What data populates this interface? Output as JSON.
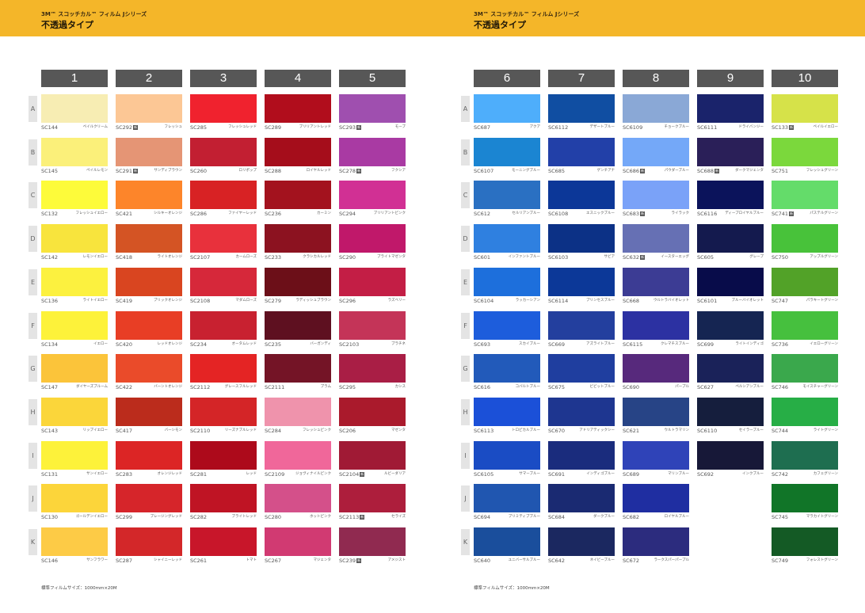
{
  "pages": [
    {
      "series": "3M™ スコッチカル™ フィルム Jシリーズ",
      "title": "不透過タイプ",
      "footnote": "標準フィルムサイズ：1000mm×20M",
      "columns": [
        {
          "label": "1",
          "cells": [
            {
              "code": "SC144",
              "mark": "",
              "name": "ペイルクリーム",
              "color": "#f7edb3"
            },
            {
              "code": "SC145",
              "mark": "",
              "name": "ペイルレモン",
              "color": "#fbf07a"
            },
            {
              "code": "SC132",
              "mark": "",
              "name": "フレッシュイエロー",
              "color": "#fdfb3a"
            },
            {
              "code": "SC142",
              "mark": "",
              "name": "レモンイエロー",
              "color": "#f8e43d"
            },
            {
              "code": "SC136",
              "mark": "",
              "name": "ライトイエロー",
              "color": "#fcf13f"
            },
            {
              "code": "SC134",
              "mark": "",
              "name": "イエロー",
              "color": "#fdf23a"
            },
            {
              "code": "SC147",
              "mark": "",
              "name": "ダイヤーズブルーム",
              "color": "#fbc43a"
            },
            {
              "code": "SC143",
              "mark": "",
              "name": "リップイエロー",
              "color": "#fbd63a"
            },
            {
              "code": "SC131",
              "mark": "",
              "name": "サンイエロー",
              "color": "#fdf23a"
            },
            {
              "code": "SC130",
              "mark": "",
              "name": "ゴールデンイエロー",
              "color": "#fcd53a"
            },
            {
              "code": "SC146",
              "mark": "",
              "name": "サンフラワー",
              "color": "#fdcb46"
            }
          ]
        },
        {
          "label": "2",
          "cells": [
            {
              "code": "SC292",
              "mark": "新",
              "name": "フレッシュ",
              "color": "#fcc795"
            },
            {
              "code": "SC291",
              "mark": "新",
              "name": "サンディブラウン",
              "color": "#e59575"
            },
            {
              "code": "SC421",
              "mark": "",
              "name": "シルキーオレンジ",
              "color": "#fd852a"
            },
            {
              "code": "SC418",
              "mark": "",
              "name": "ライトオレンジ",
              "color": "#d45424"
            },
            {
              "code": "SC419",
              "mark": "",
              "name": "ブリックオレンジ",
              "color": "#d94520"
            },
            {
              "code": "SC420",
              "mark": "",
              "name": "レッドオレンジ",
              "color": "#e83e25"
            },
            {
              "code": "SC422",
              "mark": "",
              "name": "バーントオレンジ",
              "color": "#ea4b2a"
            },
            {
              "code": "SC417",
              "mark": "",
              "name": "バーシモン",
              "color": "#bb2c1c"
            },
            {
              "code": "SC283",
              "mark": "",
              "name": "オレンジレッド",
              "color": "#dc2525"
            },
            {
              "code": "SC299",
              "mark": "",
              "name": "ブレージングレッド",
              "color": "#d6252a"
            },
            {
              "code": "SC287",
              "mark": "",
              "name": "シャイニーレッド",
              "color": "#d32729"
            }
          ]
        },
        {
          "label": "3",
          "cells": [
            {
              "code": "SC285",
              "mark": "",
              "name": "フレッシュレッド",
              "color": "#f0222e"
            },
            {
              "code": "SC260",
              "mark": "",
              "name": "ロリポップ",
              "color": "#c21f32"
            },
            {
              "code": "SC286",
              "mark": "",
              "name": "ファイヤーレッド",
              "color": "#d82224"
            },
            {
              "code": "SC2107",
              "mark": "",
              "name": "カームローズ",
              "color": "#e8313c"
            },
            {
              "code": "SC2108",
              "mark": "",
              "name": "マダムローズ",
              "color": "#d6283a"
            },
            {
              "code": "SC234",
              "mark": "",
              "name": "オータムレッド",
              "color": "#c82130"
            },
            {
              "code": "SC2112",
              "mark": "",
              "name": "グレースフルレッド",
              "color": "#e42424"
            },
            {
              "code": "SC2110",
              "mark": "",
              "name": "リーズナブルレッド",
              "color": "#d42527"
            },
            {
              "code": "SC281",
              "mark": "",
              "name": "レッド",
              "color": "#ad0a1b"
            },
            {
              "code": "SC282",
              "mark": "",
              "name": "ブライトレッド",
              "color": "#bf1424"
            },
            {
              "code": "SC261",
              "mark": "",
              "name": "トマト",
              "color": "#c8162a"
            }
          ]
        },
        {
          "label": "4",
          "cells": [
            {
              "code": "SC289",
              "mark": "",
              "name": "ブリリアントレッド",
              "color": "#b10d1c"
            },
            {
              "code": "SC288",
              "mark": "",
              "name": "ロイヤルレッド",
              "color": "#a50d1b"
            },
            {
              "code": "SC236",
              "mark": "",
              "name": "カーミン",
              "color": "#a3121e"
            },
            {
              "code": "SC233",
              "mark": "",
              "name": "クラシカルレッド",
              "color": "#8c1220"
            },
            {
              "code": "SC279",
              "mark": "",
              "name": "ラディッシュブラウン",
              "color": "#6c0f18"
            },
            {
              "code": "SC235",
              "mark": "",
              "name": "バーガンディ",
              "color": "#5e1020"
            },
            {
              "code": "SC2111",
              "mark": "",
              "name": "プラム",
              "color": "#741426"
            },
            {
              "code": "SC284",
              "mark": "",
              "name": "フレッシュピンク",
              "color": "#ef93ac"
            },
            {
              "code": "SC2109",
              "mark": "",
              "name": "ジョヴィナイルピンク",
              "color": "#f0679a"
            },
            {
              "code": "SC280",
              "mark": "",
              "name": "ホットピンク",
              "color": "#d4508a"
            },
            {
              "code": "SC267",
              "mark": "",
              "name": "マジェンタ",
              "color": "#d13a72"
            }
          ]
        },
        {
          "label": "5",
          "cells": [
            {
              "code": "SC293",
              "mark": "新",
              "name": "モーブ",
              "color": "#9f4faf"
            },
            {
              "code": "SC278",
              "mark": "新",
              "name": "フクシア",
              "color": "#a93aa3"
            },
            {
              "code": "SC294",
              "mark": "",
              "name": "ブリリアントピンク",
              "color": "#d13094"
            },
            {
              "code": "SC290",
              "mark": "",
              "name": "ブライトマゼンタ",
              "color": "#c0186a"
            },
            {
              "code": "SC296",
              "mark": "",
              "name": "ラズベリー",
              "color": "#c31e45"
            },
            {
              "code": "SC2103",
              "mark": "",
              "name": "プラチネ",
              "color": "#c43458"
            },
            {
              "code": "SC295",
              "mark": "",
              "name": "カシス",
              "color": "#a91e45"
            },
            {
              "code": "SC206",
              "mark": "",
              "name": "マゼンタ",
              "color": "#aa1a2c"
            },
            {
              "code": "SC2104",
              "mark": "新",
              "name": "ルビーダリア",
              "color": "#a01a35"
            },
            {
              "code": "SC2113",
              "mark": "新",
              "name": "セライズ",
              "color": "#ad1e3c"
            },
            {
              "code": "SC239",
              "mark": "新",
              "name": "アメジスト",
              "color": "#902a50"
            }
          ]
        }
      ]
    },
    {
      "series": "3M™ スコッチカル™ フィルム Jシリーズ",
      "title": "不透過タイプ",
      "footnote": "標準フィルムサイズ：1000mm×20M",
      "columns": [
        {
          "label": "6",
          "cells": [
            {
              "code": "SC687",
              "mark": "",
              "name": "アクア",
              "color": "#4eaefb"
            },
            {
              "code": "SC6107",
              "mark": "",
              "name": "モーニングブルー",
              "color": "#1b85d2"
            },
            {
              "code": "SC612",
              "mark": "",
              "name": "セルリアンブルー",
              "color": "#2a70c2"
            },
            {
              "code": "SC601",
              "mark": "",
              "name": "インファントブルー",
              "color": "#2f80e0"
            },
            {
              "code": "SC6104",
              "mark": "",
              "name": "ラッカーシアン",
              "color": "#1d6fdc"
            },
            {
              "code": "SC693",
              "mark": "",
              "name": "スカイブルー",
              "color": "#1d5ddc"
            },
            {
              "code": "SC616",
              "mark": "",
              "name": "コバルトブルー",
              "color": "#225aba"
            },
            {
              "code": "SC6113",
              "mark": "",
              "name": "トロピカルブルー",
              "color": "#1b50d8"
            },
            {
              "code": "SC6105",
              "mark": "",
              "name": "サマーブルー",
              "color": "#1a4cc4"
            },
            {
              "code": "SC694",
              "mark": "",
              "name": "ブリミティブブルー",
              "color": "#2056b0"
            },
            {
              "code": "SC640",
              "mark": "",
              "name": "ユニバーサルブルー",
              "color": "#1a4e9c"
            }
          ]
        },
        {
          "label": "7",
          "cells": [
            {
              "code": "SC6112",
              "mark": "",
              "name": "デザートブルー",
              "color": "#104ea2"
            },
            {
              "code": "SC685",
              "mark": "",
              "name": "ゲンチアナ",
              "color": "#2240a8"
            },
            {
              "code": "SC6108",
              "mark": "",
              "name": "エスニックブルー",
              "color": "#0c3798"
            },
            {
              "code": "SC6103",
              "mark": "",
              "name": "サビア",
              "color": "#0c3186"
            },
            {
              "code": "SC6114",
              "mark": "",
              "name": "プリンセスブルー",
              "color": "#0c3898"
            },
            {
              "code": "SC669",
              "mark": "",
              "name": "アズライトブルー",
              "color": "#233f9e"
            },
            {
              "code": "SC675",
              "mark": "",
              "name": "ビビットブルー",
              "color": "#1f3e9f"
            },
            {
              "code": "SC670",
              "mark": "",
              "name": "アドリアティックシー",
              "color": "#1e3690"
            },
            {
              "code": "SC691",
              "mark": "",
              "name": "インディゴブルー",
              "color": "#1a2c7d"
            },
            {
              "code": "SC684",
              "mark": "",
              "name": "ダークブルー",
              "color": "#1a2a72"
            },
            {
              "code": "SC642",
              "mark": "",
              "name": "ネイビーブルー",
              "color": "#1b2860"
            }
          ]
        },
        {
          "label": "8",
          "cells": [
            {
              "code": "SC6109",
              "mark": "",
              "name": "チョークブルー",
              "color": "#8aa8d6"
            },
            {
              "code": "SC686",
              "mark": "新",
              "name": "パウダーブルー",
              "color": "#74a8f8"
            },
            {
              "code": "SC683",
              "mark": "新",
              "name": "ライラック",
              "color": "#7aa2f8"
            },
            {
              "code": "SC632",
              "mark": "新",
              "name": "イースターエッグ",
              "color": "#6670b4"
            },
            {
              "code": "SC668",
              "mark": "",
              "name": "ウルトラバイオレット",
              "color": "#3c3c94"
            },
            {
              "code": "SC6115",
              "mark": "",
              "name": "クレマチスブルー",
              "color": "#2c31a2"
            },
            {
              "code": "SC690",
              "mark": "",
              "name": "パープル",
              "color": "#57297c"
            },
            {
              "code": "SC621",
              "mark": "",
              "name": "ウルトラマリン",
              "color": "#274486"
            },
            {
              "code": "SC689",
              "mark": "",
              "name": "マリンブルー",
              "color": "#2f43b8"
            },
            {
              "code": "SC682",
              "mark": "",
              "name": "ロイヤルブルー",
              "color": "#1f2ea1"
            },
            {
              "code": "SC672",
              "mark": "",
              "name": "ラークスパーパープル",
              "color": "#2c2c7e"
            }
          ]
        },
        {
          "label": "9",
          "cells": [
            {
              "code": "SC6111",
              "mark": "",
              "name": "ドライバンジー",
              "color": "#1a236b"
            },
            {
              "code": "SC688",
              "mark": "新",
              "name": "ダークマジェンタ",
              "color": "#2a1f58"
            },
            {
              "code": "SC6116",
              "mark": "",
              "name": "ディープロイヤルブルー",
              "color": "#0b135b"
            },
            {
              "code": "SC605",
              "mark": "",
              "name": "グレープ",
              "color": "#141a4e"
            },
            {
              "code": "SC6101",
              "mark": "",
              "name": "ブルーバイオレット",
              "color": "#080c4a"
            },
            {
              "code": "SC699",
              "mark": "",
              "name": "ライトインディゴ",
              "color": "#152552"
            },
            {
              "code": "SC627",
              "mark": "",
              "name": "ペルシアンブルー",
              "color": "#1a2259"
            },
            {
              "code": "SC6110",
              "mark": "",
              "name": "セイラーブルー",
              "color": "#151e3d"
            },
            {
              "code": "SC692",
              "mark": "",
              "name": "インクブルー",
              "color": "#171838"
            }
          ]
        },
        {
          "label": "10",
          "cells": [
            {
              "code": "SC133",
              "mark": "新",
              "name": "ペイルイエロー",
              "color": "#d6e249"
            },
            {
              "code": "SC751",
              "mark": "",
              "name": "フレッシュグリーン",
              "color": "#7bd83c"
            },
            {
              "code": "SC741",
              "mark": "新",
              "name": "パステルグリーン",
              "color": "#64dc6a"
            },
            {
              "code": "SC750",
              "mark": "",
              "name": "アップルグリーン",
              "color": "#48c23a"
            },
            {
              "code": "SC747",
              "mark": "",
              "name": "パラキートグリーン",
              "color": "#52a228"
            },
            {
              "code": "SC736",
              "mark": "",
              "name": "イエローグリーン",
              "color": "#46c03e"
            },
            {
              "code": "SC746",
              "mark": "",
              "name": "モイスチャーグリーン",
              "color": "#3aa84c"
            },
            {
              "code": "SC744",
              "mark": "",
              "name": "ライトグリーン",
              "color": "#27ae46"
            },
            {
              "code": "SC742",
              "mark": "",
              "name": "カフェグリーン",
              "color": "#1e6e50"
            },
            {
              "code": "SC745",
              "mark": "",
              "name": "マラカイトグリーン",
              "color": "#117528"
            },
            {
              "code": "SC749",
              "mark": "",
              "name": "フォレストグリーン",
              "color": "#145a25"
            }
          ]
        }
      ]
    }
  ],
  "rows": [
    "A",
    "B",
    "C",
    "D",
    "E",
    "F",
    "G",
    "H",
    "I",
    "J",
    "K"
  ]
}
